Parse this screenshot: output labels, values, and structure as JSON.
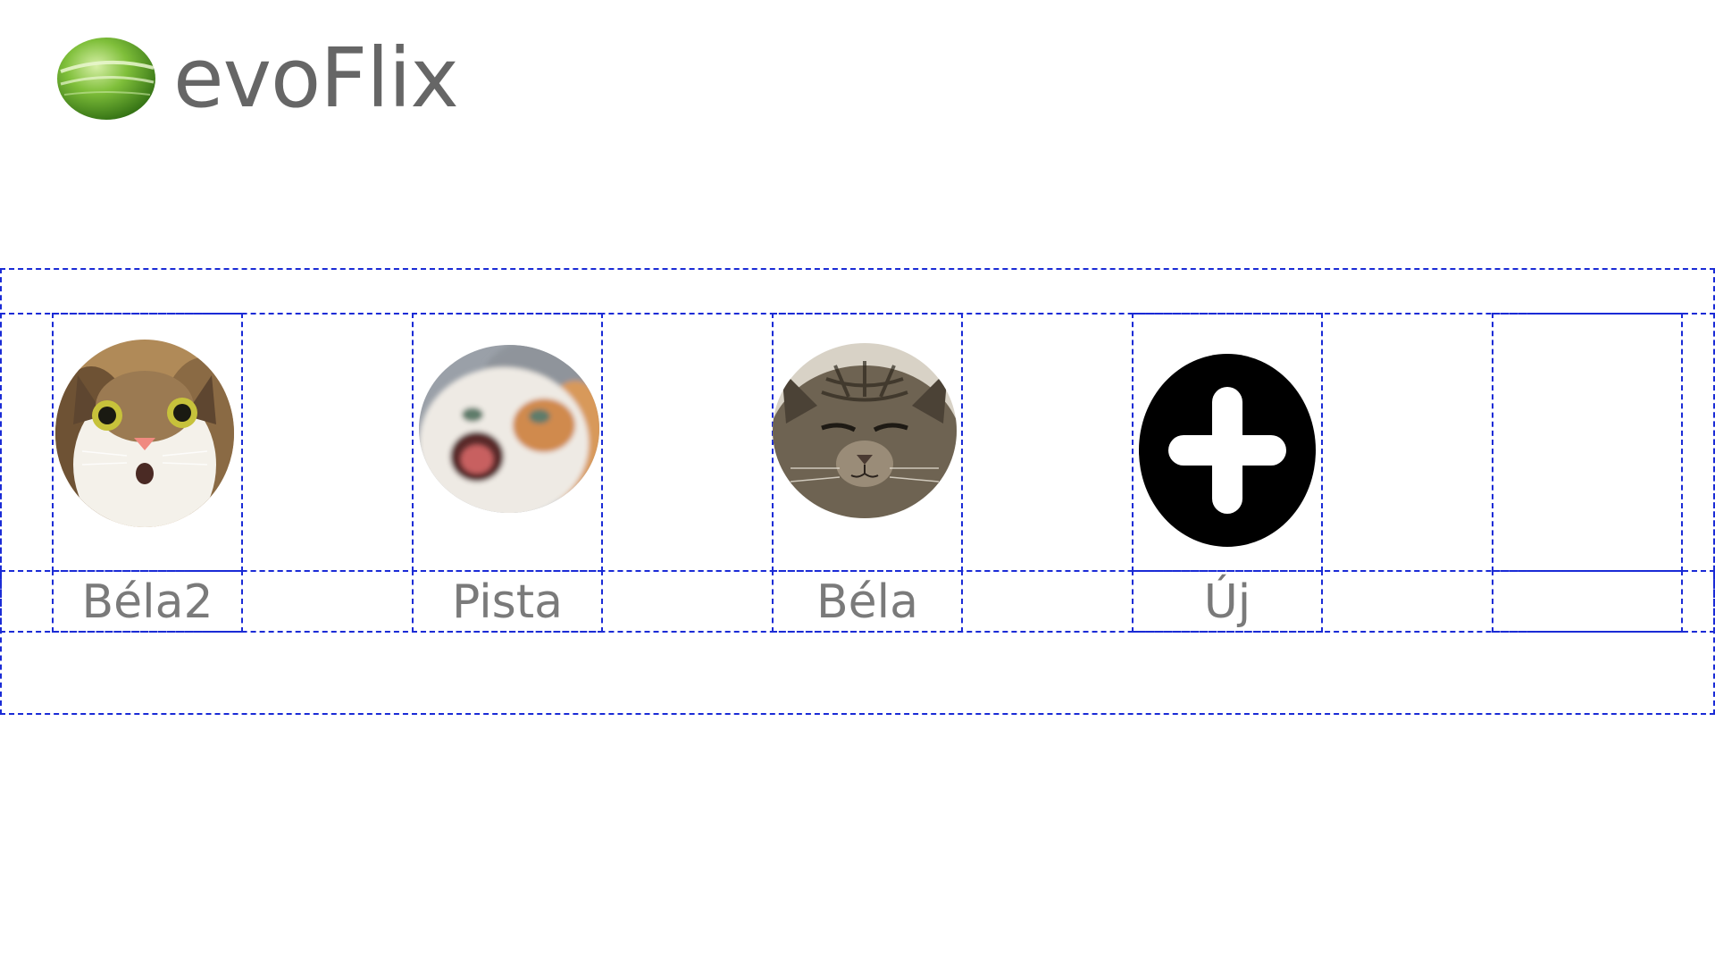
{
  "brand": {
    "name": "evoFlix",
    "accent_color": "#6bab2f",
    "logo_icon": "green-sphere-logo"
  },
  "profiles": [
    {
      "label": "Béla2",
      "avatar": "cat-surprised-avatar"
    },
    {
      "label": "Pista",
      "avatar": "cat-screaming-avatar"
    },
    {
      "label": "Béla",
      "avatar": "cat-tabby-avatar"
    },
    {
      "label": "Új",
      "avatar": "plus-circle-icon"
    },
    {
      "label": "",
      "avatar": ""
    }
  ],
  "colors": {
    "debug_outline": "#1a2bd6",
    "label_text": "#7a7a7a",
    "add_icon": "#000000"
  }
}
